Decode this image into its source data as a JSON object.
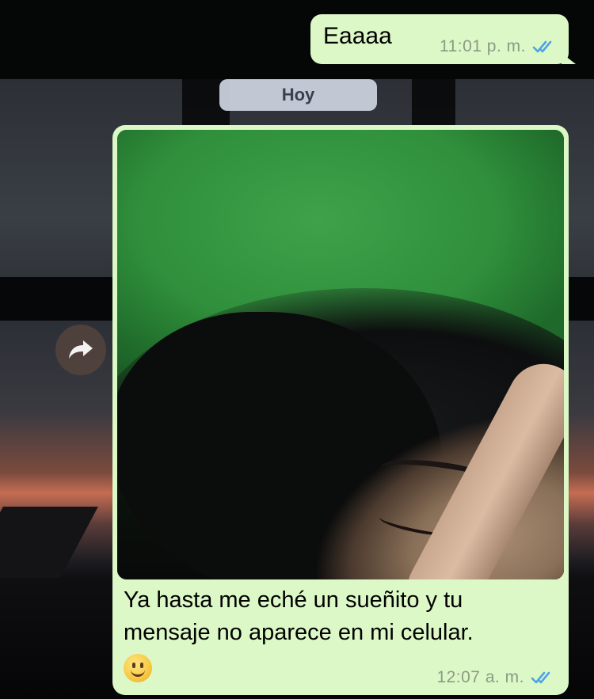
{
  "messages": [
    {
      "text": "Eaaaa",
      "time": "11:01 p. m.",
      "status_icon": "double-check-read-icon"
    },
    {
      "type": "image",
      "caption_line1": "Ya hasta me eché un sueñito y tu",
      "caption_line2": "mensaje no aparece en mi celular.",
      "emoji": "slightly-smiling-face-emoji",
      "time": "12:07 a. m.",
      "status_icon": "double-check-read-icon"
    }
  ],
  "date_divider": "Hoy",
  "forward_icon": "forward-arrow-icon",
  "colors": {
    "outgoing_bubble": "#dcf8c6",
    "read_ticks": "#4fa3e6",
    "meta_text": "#8c9a86",
    "date_pill": "#c9d0dc"
  }
}
